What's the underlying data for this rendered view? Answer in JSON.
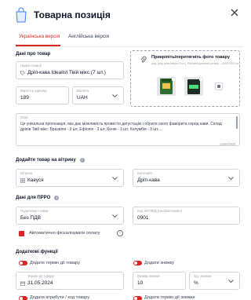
{
  "header": {
    "title": "Товарна позиція"
  },
  "tabs": [
    {
      "label": "Українська версія",
      "active": true
    },
    {
      "label": "Англійська версія",
      "active": false
    }
  ],
  "product": {
    "section_title": "Дані про товар",
    "name_label": "Назва позиції",
    "name_value": "Дріп-кава Idealist Твій мікс (7 шт.)",
    "price_label": "Вартість одиниці",
    "price_value": "189",
    "currency_label": "Валюта",
    "currency_value": "UAH"
  },
  "photo": {
    "title": "Прикріпіть/перетягніть фото товару",
    "subtitle": "png, jpeg (максимум 5 шт.). Рекомендований розмір - 1200*1200 px"
  },
  "description": {
    "label": "Опис",
    "text": "Це унікальна пропозиція, яка дає можливість провести дегустацію і обрати свого фаворита серед кави. Склад дріпів Твій мікс: Бразилія - 3 шт, Ефіопія - 3 шт, Кенія - 3 шт, Колумбія - 3 шт,...",
    "counter": "1248/2000"
  },
  "showcase": {
    "section_title": "Додайте товар на вітрину",
    "group_label": "Вітрина",
    "group_value": "Кавуся",
    "category_label": "Категорія",
    "category_value": "Дріп-кава"
  },
  "prro": {
    "section_title": "Дані для ПРРО",
    "tax_label": "Податкова ставка",
    "tax_value": "Без ПДВ",
    "uktzed_label": "Код УКТЗЕД (необов'язково)",
    "uktzed_value": "0901",
    "auto_fiscal_label": "Автоматично фіскалізувати оплату"
  },
  "extra": {
    "section_title": "Додаткові функції",
    "toggle_term_label": "Додати термін дії товару",
    "toggle_discount_label": "Додати знижку",
    "term_date_label": "Термін дії товару",
    "term_date_value": "31.05.2024",
    "discount_size_label": "Розмір знижки",
    "discount_size_value": "10",
    "discount_unit_label": "Од. знижки",
    "discount_unit_value": "%",
    "toggle_attr_label": "Додати атрибути / код товару",
    "toggle_term_discount_label": "Додати термін дії знижки"
  },
  "colors": {
    "accent": "#dc2626",
    "border": "#d1d5db",
    "muted": "#9ca3af"
  }
}
